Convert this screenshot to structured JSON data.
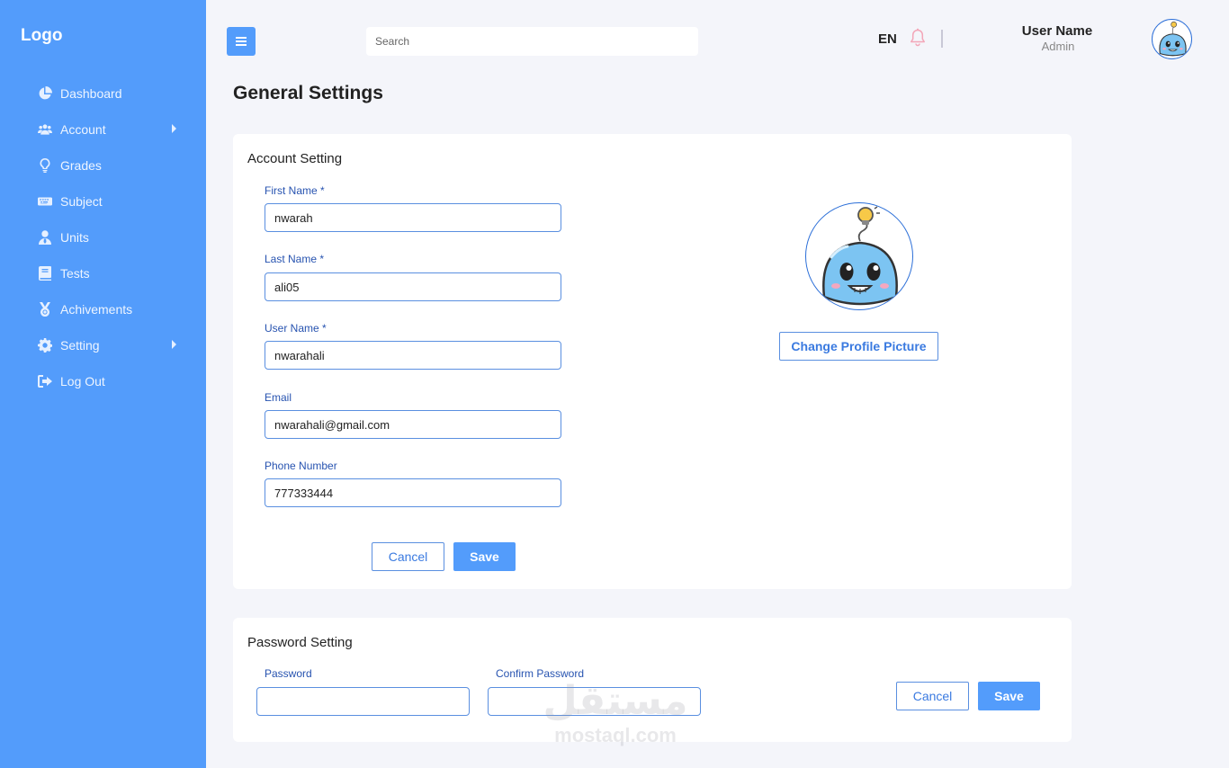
{
  "sidebar": {
    "logo": "Logo",
    "items": [
      {
        "label": "Dashboard",
        "icon": "pie-chart-icon"
      },
      {
        "label": "Account",
        "icon": "users-icon",
        "has_submenu": true
      },
      {
        "label": "Grades",
        "icon": "lightbulb-icon"
      },
      {
        "label": "Subject",
        "icon": "keyboard-icon"
      },
      {
        "label": "Units",
        "icon": "user-tie-icon"
      },
      {
        "label": "Tests",
        "icon": "book-icon"
      },
      {
        "label": "Achivements",
        "icon": "medal-icon"
      },
      {
        "label": "Setting",
        "icon": "gear-icon",
        "has_submenu": true
      },
      {
        "label": "Log Out",
        "icon": "sign-out-icon"
      }
    ]
  },
  "header": {
    "search_placeholder": "Search",
    "language": "EN",
    "user_name": "User Name",
    "user_role": "Admin"
  },
  "page": {
    "title": "General Settings"
  },
  "account_setting": {
    "title": "Account Setting",
    "first_name_label": "First Name *",
    "first_name_value": "nwarah",
    "last_name_label": "Last Name *",
    "last_name_value": "ali05",
    "user_name_label": "User Name *",
    "user_name_value": "nwarahali",
    "email_label": "Email",
    "email_value": "nwarahali@gmail.com",
    "phone_label": "Phone Number",
    "phone_value": "777333444",
    "cancel_label": "Cancel",
    "save_label": "Save",
    "change_picture_label": "Change Profile Picture"
  },
  "password_setting": {
    "title": "Password Setting",
    "password_label": "Password",
    "password_value": "",
    "confirm_label": "Confirm Password",
    "confirm_value": "",
    "cancel_label": "Cancel",
    "save_label": "Save"
  },
  "watermark": {
    "arabic": "مستقل",
    "latin": "mostaql.com"
  },
  "colors": {
    "sidebar": "#539cfb",
    "accent": "#539cfb",
    "label": "#2753b0",
    "border": "#5a8fe0",
    "background": "#f4f5fa"
  }
}
